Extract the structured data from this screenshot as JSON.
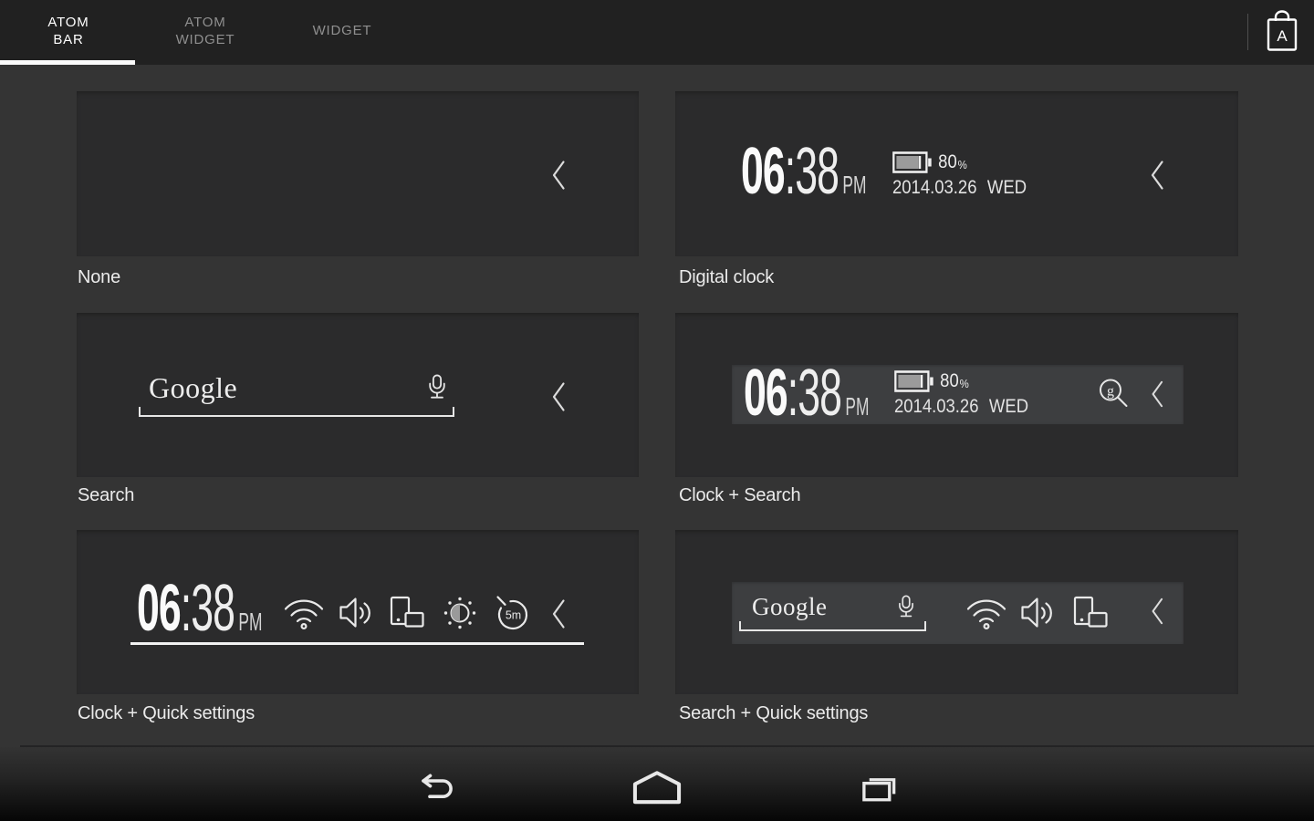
{
  "header": {
    "tabs": [
      {
        "label": "ATOM BAR",
        "active": true
      },
      {
        "label": "ATOM WIDGET",
        "active": false
      },
      {
        "label": "WIDGET",
        "active": false
      }
    ],
    "store_letter": "A"
  },
  "clock": {
    "hours": "06",
    "minutes": ":38",
    "meridiem": "PM"
  },
  "status": {
    "battery_percent": "80",
    "percent_sign": "%",
    "date": "2014.03.26",
    "weekday": "WED"
  },
  "search": {
    "logo": "Google",
    "g_glyph": "g"
  },
  "timer": {
    "label": "5m"
  },
  "cards": [
    {
      "label": "None"
    },
    {
      "label": "Digital clock"
    },
    {
      "label": "Search"
    },
    {
      "label": "Clock + Search"
    },
    {
      "label": "Clock + Quick settings"
    },
    {
      "label": "Search + Quick settings"
    }
  ],
  "colors": {
    "page_bg": "#343434",
    "header_bg": "#212121",
    "card_bg": "#2b2b2c",
    "bar_bg": "#3d3e40",
    "active_tab_underline": "#fbfbfb",
    "battery_fill": "#9b9b9b"
  }
}
